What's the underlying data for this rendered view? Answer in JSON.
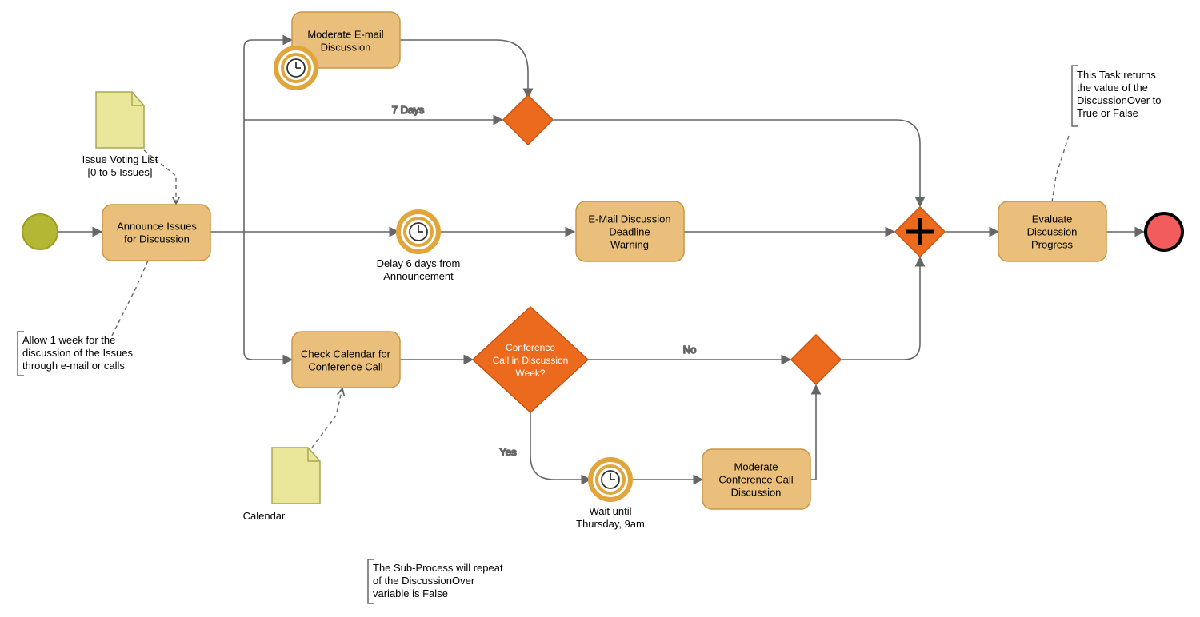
{
  "tasks": {
    "announce": {
      "line1": "Announce Issues",
      "line2": "for Discussion"
    },
    "moderateEmail": {
      "line1": "Moderate E-mail",
      "line2": "Discussion"
    },
    "deadlineWarning": {
      "line1": "E-Mail Discussion",
      "line2": "Deadline",
      "line3": "Warning"
    },
    "checkCalendar": {
      "line1": "Check Calendar for",
      "line2": "Conference Call"
    },
    "moderateCall": {
      "line1": "Moderate",
      "line2": "Conference Call",
      "line3": "Discussion"
    },
    "evaluate": {
      "line1": "Evaluate",
      "line2": "Discussion",
      "line3": "Progress"
    }
  },
  "gateways": {
    "confCall": {
      "line1": "Conference",
      "line2": "Call in Discussion",
      "line3": "Week?"
    }
  },
  "timers": {
    "delay6": {
      "line1": "Delay 6 days from",
      "line2": "Announcement"
    },
    "waitThu": {
      "line1": "Wait until",
      "line2": "Thursday, 9am"
    }
  },
  "documents": {
    "voting": {
      "line1": "Issue Voting List",
      "line2": "[0 to 5 Issues]"
    },
    "calendar": "Calendar"
  },
  "edgeLabels": {
    "sevenDays": "7 Days",
    "no": "No",
    "yes": "Yes"
  },
  "annotations": {
    "allowWeek": {
      "line1": "Allow 1 week for the",
      "line2": "discussion of the Issues",
      "line3": "through e-mail or calls"
    },
    "taskReturns": {
      "line1": "This Task returns",
      "line2": "the value of the",
      "line3": "DiscussionOver to",
      "line4": "True or False"
    },
    "subRepeat": {
      "line1": "The Sub-Process will repeat",
      "line2": "of the DiscussionOver",
      "line3": "variable is False"
    }
  }
}
